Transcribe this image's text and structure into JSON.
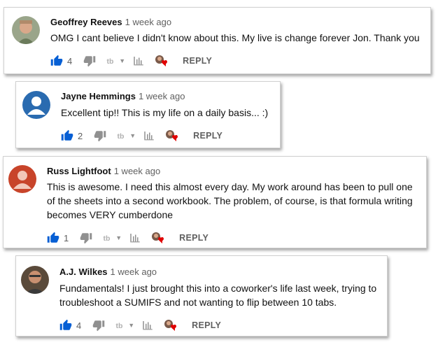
{
  "comments": [
    {
      "author": "Geoffrey Reeves",
      "time": "1 week ago",
      "text": "OMG I cant believe I didn't know about this. My live is change forever Jon. Thank you",
      "likes": "4",
      "reply_label": "REPLY"
    },
    {
      "author": "Jayne Hemmings",
      "time": "1 week ago",
      "text": "Excellent tip!! This is my life on a daily basis... :)",
      "likes": "2",
      "reply_label": "REPLY"
    },
    {
      "author": "Russ Lightfoot",
      "time": "1 week ago",
      "text": "This is awesome. I need this almost every day. My work around has been to pull one of the sheets into a second workbook. The problem, of course, is that formula writing becomes VERY cumberdone",
      "likes": "1",
      "reply_label": "REPLY"
    },
    {
      "author": "A.J. Wilkes",
      "time": "1 week ago",
      "text": "Fundamentals!  I just brought this into a coworker's life last week, trying to troubleshoot a SUMIFS and not wanting to flip between 10 tabs.",
      "likes": "4",
      "reply_label": "REPLY"
    }
  ],
  "colors": {
    "like_active": "#065fd4",
    "icon_gray": "#909090",
    "heart": "#e00000",
    "avatar_blue": "#2a6bb0",
    "avatar_orange": "#c8442a"
  },
  "icons": [
    "thumbs-up-icon",
    "thumbs-down-icon",
    "tube-buddy-icon",
    "analytics-icon",
    "creator-heart-icon"
  ]
}
